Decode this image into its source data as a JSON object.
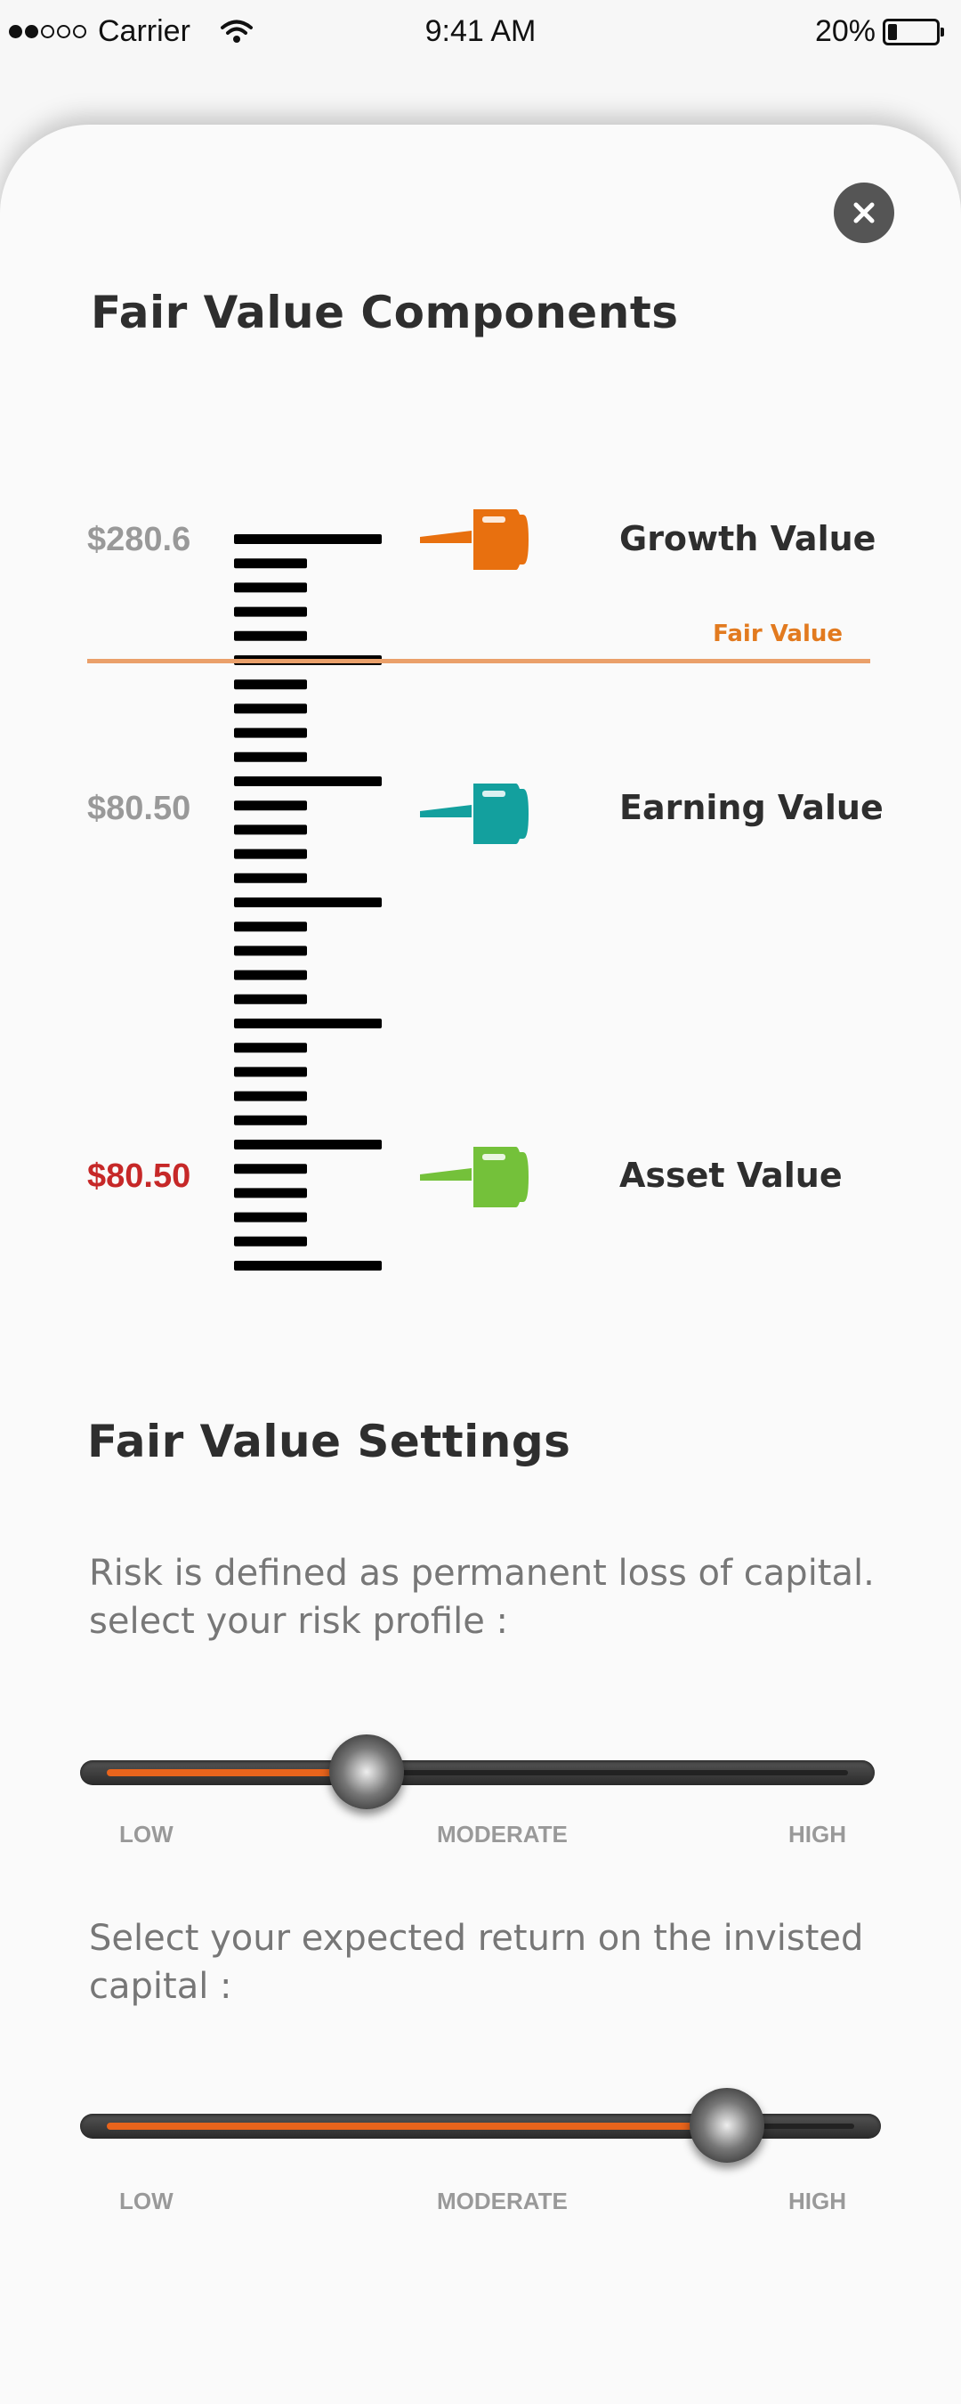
{
  "status_bar": {
    "carrier": "Carrier",
    "time": "9:41 AM",
    "battery_percent": "20%",
    "battery_level": 0.2
  },
  "title": "Fair Value Components",
  "close_icon": "close-icon",
  "gauge": {
    "components": [
      {
        "value_label": "$280.6",
        "name": "Growth Value",
        "color": "#e8700f"
      },
      {
        "value_label": "$80.50",
        "name": "Earning Value",
        "color": "#13a09e"
      },
      {
        "value_label": "$80.50",
        "name": "Asset Value",
        "color": "#74c13a"
      }
    ],
    "fair_value_label": "Fair Value",
    "fair_value_color": "#e27a1f"
  },
  "settings": {
    "title": "Fair Value Settings",
    "risk": {
      "description": "Risk is defined as permanent loss of capital. select your risk profile :",
      "value": 0.35,
      "ticks": [
        "LOW",
        "MODERATE",
        "HIGH"
      ]
    },
    "return": {
      "description": "Select your expected return on the invisted capital :",
      "value": 0.83,
      "ticks": [
        "LOW",
        "MODERATE",
        "HIGH"
      ]
    },
    "accent_color": "#e8641c"
  }
}
